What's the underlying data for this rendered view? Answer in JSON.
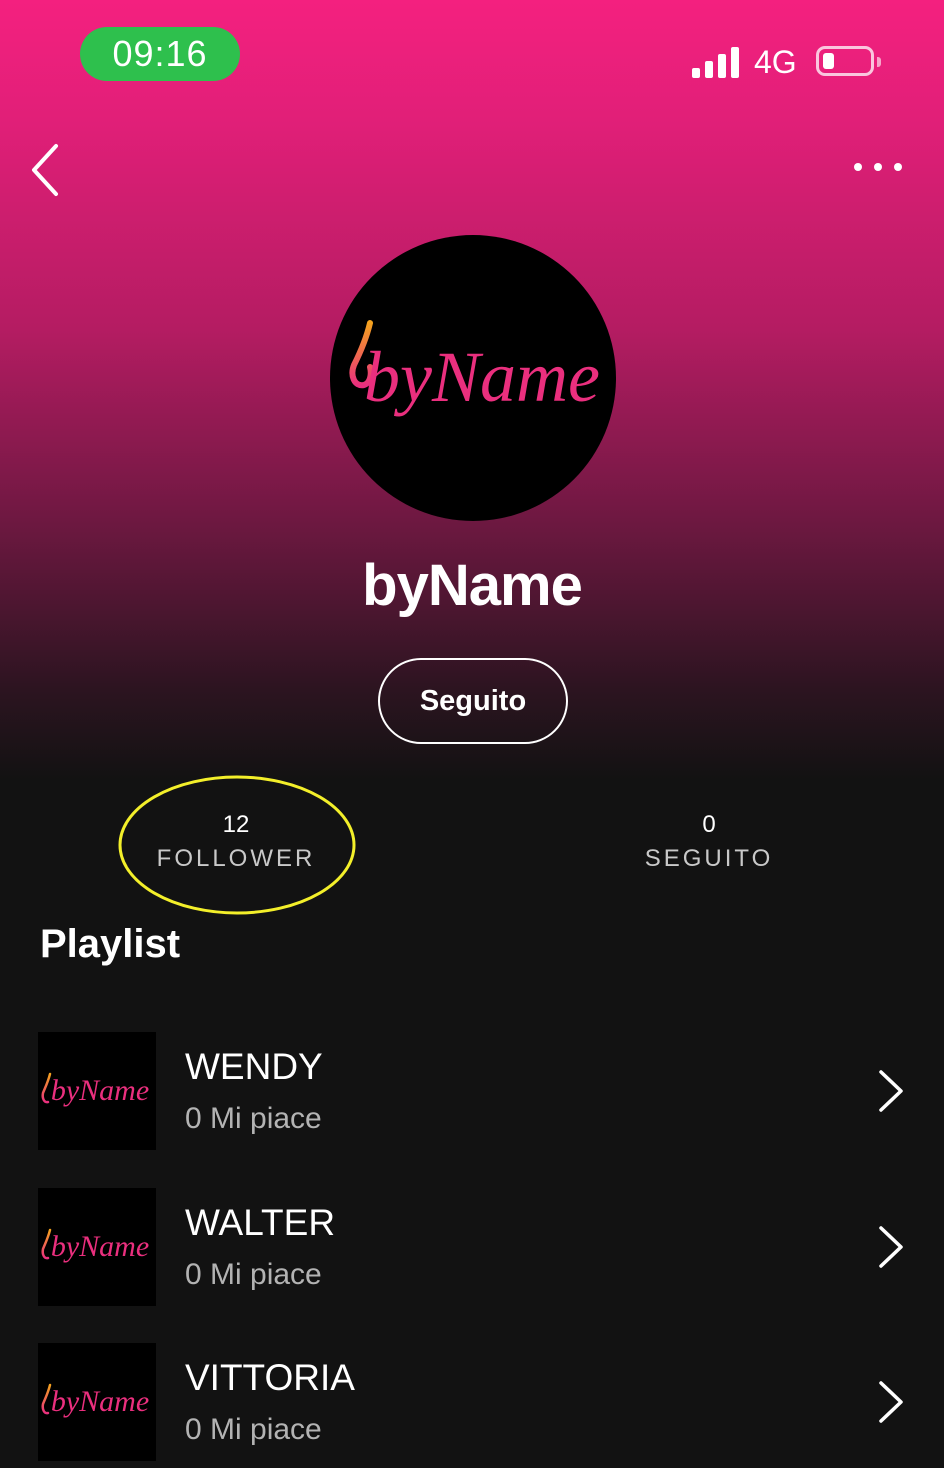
{
  "status_bar": {
    "time": "09:16",
    "network": "4G",
    "battery_level": 0.25
  },
  "nav": {
    "back_icon": "chevron-left-icon",
    "more_icon": "ellipsis-icon"
  },
  "profile": {
    "logo_text": "byName",
    "name": "byName",
    "follow_button_label": "Seguito"
  },
  "stats": {
    "followers": {
      "count": "12",
      "label": "FOLLOWER"
    },
    "following": {
      "count": "0",
      "label": "SEGUITO"
    }
  },
  "playlists_section": {
    "title": "Playlist",
    "items": [
      {
        "name": "WENDY",
        "likes": "0 Mi piace",
        "thumb_text": "byName"
      },
      {
        "name": "WALTER",
        "likes": "0 Mi piace",
        "thumb_text": "byName"
      },
      {
        "name": "VITTORIA",
        "likes": "0 Mi piace",
        "thumb_text": "byName"
      }
    ]
  },
  "colors": {
    "accent_pink": "#f4207f",
    "status_green": "#2ec04d",
    "highlight_yellow": "#f3ef2a",
    "background": "#121212"
  }
}
